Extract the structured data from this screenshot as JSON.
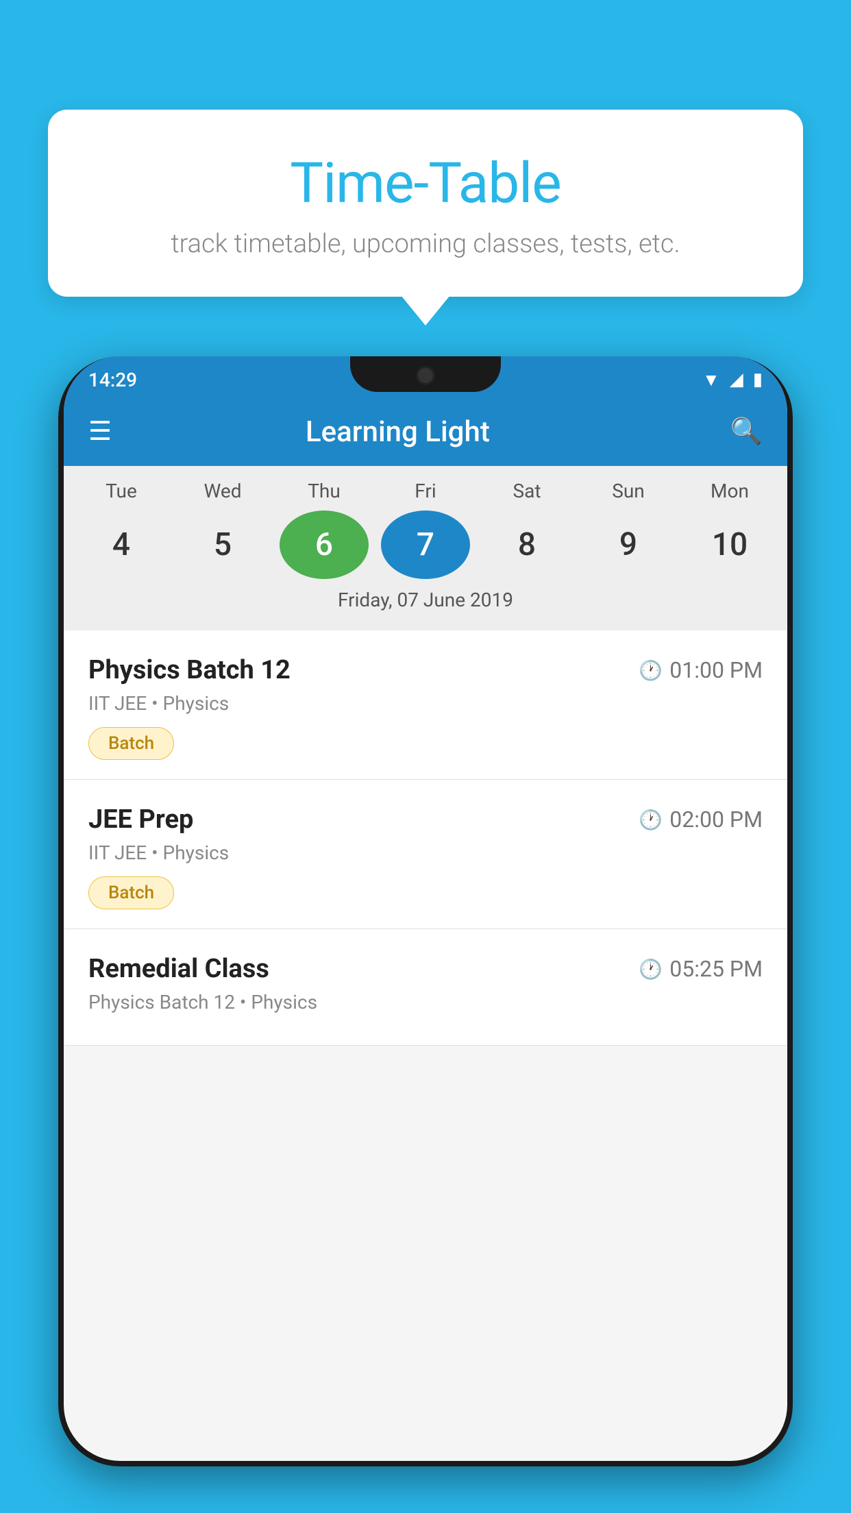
{
  "background_color": "#29b6e8",
  "bubble": {
    "title": "Time-Table",
    "subtitle": "track timetable, upcoming classes, tests, etc."
  },
  "phone": {
    "status_bar": {
      "time": "14:29"
    },
    "app_bar": {
      "title": "Learning Light"
    },
    "calendar": {
      "days": [
        "Tue",
        "Wed",
        "Thu",
        "Fri",
        "Sat",
        "Sun",
        "Mon"
      ],
      "dates": [
        "4",
        "5",
        "6",
        "7",
        "8",
        "9",
        "10"
      ],
      "today_index": 2,
      "selected_index": 3,
      "selected_label": "Friday, 07 June 2019"
    },
    "schedule": [
      {
        "title": "Physics Batch 12",
        "time": "01:00 PM",
        "subtitle": "IIT JEE • Physics",
        "badge": "Batch"
      },
      {
        "title": "JEE Prep",
        "time": "02:00 PM",
        "subtitle": "IIT JEE • Physics",
        "badge": "Batch"
      },
      {
        "title": "Remedial Class",
        "time": "05:25 PM",
        "subtitle": "Physics Batch 12 • Physics",
        "badge": ""
      }
    ]
  }
}
